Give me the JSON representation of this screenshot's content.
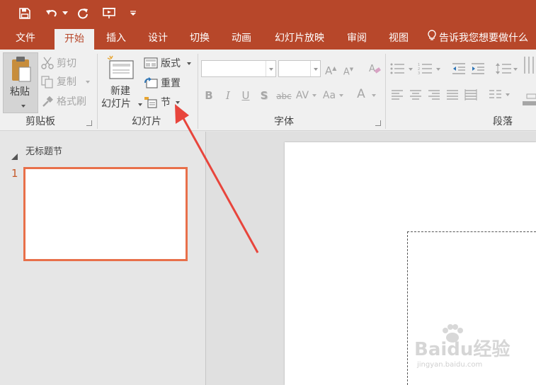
{
  "quick_access": {
    "save_icon": "save-icon",
    "undo_icon": "undo-icon",
    "redo_icon": "redo-icon",
    "presenter_icon": "start-from-beginning-icon",
    "customize_icon": "customize-toolbar-icon"
  },
  "tabs": [
    {
      "label": "文件"
    },
    {
      "label": "开始",
      "active": true
    },
    {
      "label": "插入"
    },
    {
      "label": "设计"
    },
    {
      "label": "切换"
    },
    {
      "label": "动画"
    },
    {
      "label": "幻灯片放映"
    },
    {
      "label": "审阅"
    },
    {
      "label": "视图"
    }
  ],
  "tell_me": {
    "icon": "lightbulb-icon",
    "text": "告诉我您想要做什么"
  },
  "ribbon": {
    "clipboard": {
      "paste": "粘贴",
      "cut": "剪切",
      "copy": "复制",
      "format_painter": "格式刷",
      "group_label": "剪贴板"
    },
    "slides": {
      "new_slide_line1": "新建",
      "new_slide_line2": "幻灯片",
      "layout": "版式",
      "reset": "重置",
      "section": "节",
      "group_label": "幻灯片"
    },
    "font": {
      "font_name": "",
      "font_size": "",
      "grow": "A",
      "shrink": "A",
      "bold": "B",
      "italic": "I",
      "underline": "U",
      "shadow": "S",
      "strike": "abc",
      "spacing": "AV",
      "change_case": "Aa",
      "font_color": "A",
      "group_label": "字体"
    },
    "paragraph": {
      "group_label": "段落"
    }
  },
  "slides_panel": {
    "section_title": "无标题节",
    "slide_number": "1"
  },
  "colors": {
    "accent": "#b7472a",
    "tab_bg": "#b7472a",
    "ribbon_bg": "#f0f0f0",
    "slide_border": "#e8704a",
    "arrow": "#e8453c"
  },
  "watermark": {
    "line1": "Baidu经验",
    "line2": "jingyan.baidu.com"
  }
}
